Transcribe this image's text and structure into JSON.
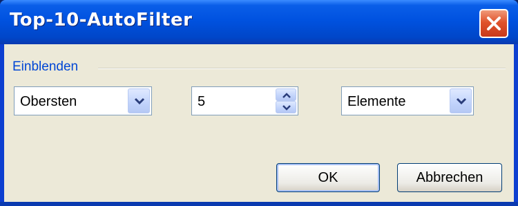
{
  "window": {
    "title": "Top-10-AutoFilter"
  },
  "group": {
    "label": "Einblenden"
  },
  "controls": {
    "direction": {
      "value": "Obersten"
    },
    "count": {
      "value": "5"
    },
    "unit": {
      "value": "Elemente"
    }
  },
  "buttons": {
    "ok": "OK",
    "cancel": "Abbrechen"
  },
  "icons": {
    "close": "close-icon",
    "dropdown": "chevron-down-icon",
    "spin_up": "arrow-up-icon",
    "spin_down": "arrow-down-icon"
  },
  "colors": {
    "titlebar": "#0052e0",
    "close": "#e0532c",
    "group_label": "#0046d5",
    "client": "#ece9d8"
  }
}
